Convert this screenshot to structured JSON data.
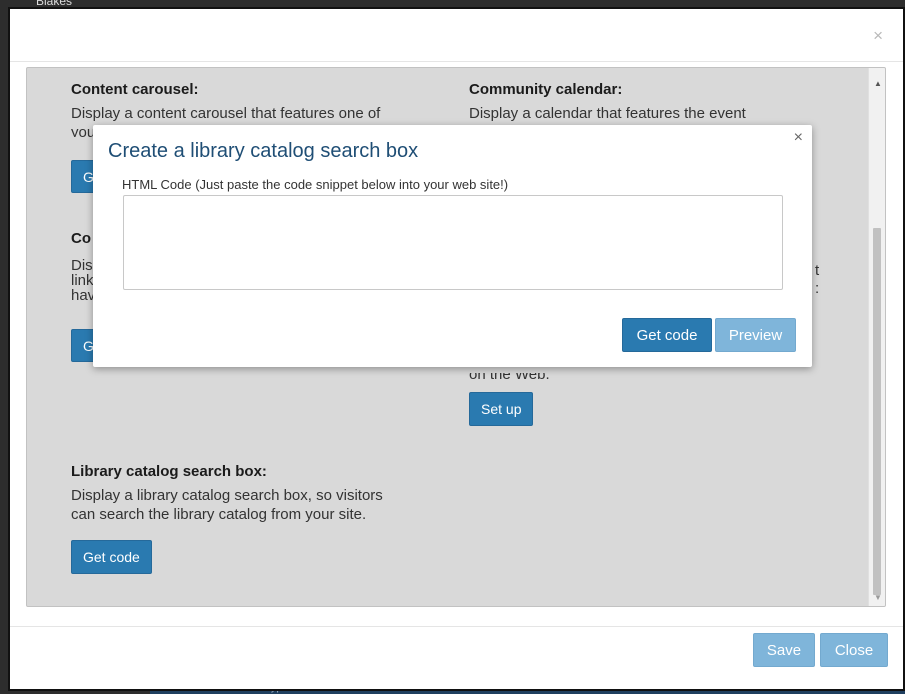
{
  "background": {
    "top_text": "Blakes",
    "bottom_text": "Create an Item type"
  },
  "outer_modal": {
    "close_glyph": "×",
    "widgets": {
      "content_carousel": {
        "title": "Content carousel:",
        "desc_line1": "Display a content carousel that features one of",
        "desc_line2": "your",
        "button_partial": "G"
      },
      "community_calendar": {
        "title": "Community calendar:",
        "desc_line1": "Display a calendar that features the event"
      },
      "left_second": {
        "title_partial": "Co",
        "desc_partial_1": "Dis",
        "desc_partial_2": "link",
        "desc_partial_3": "hav",
        "button_partial": "G"
      },
      "right_second": {
        "desc_partial_1": "t",
        "desc_partial_2": ":",
        "desc_tail": "on the Web.",
        "button_label": "Set up"
      },
      "library_catalog": {
        "title": "Library catalog search box:",
        "desc_line1": "Display a library catalog search box, so visitors",
        "desc_line2": "can search the library catalog from your site.",
        "button_label": "Get code"
      }
    },
    "footer": {
      "save_label": "Save",
      "close_label": "Close"
    }
  },
  "inner_modal": {
    "title": "Create a library catalog search box",
    "close_glyph": "×",
    "code_label": "HTML Code (Just paste the code snippet below into your web site!)",
    "code_value": "",
    "get_code_label": "Get code",
    "preview_label": "Preview"
  },
  "colors": {
    "primary_button": "#2a7ab0",
    "disabled_button": "#7fb5da",
    "panel_bg": "#d9d9d9",
    "title_blue": "#1f4e75"
  }
}
